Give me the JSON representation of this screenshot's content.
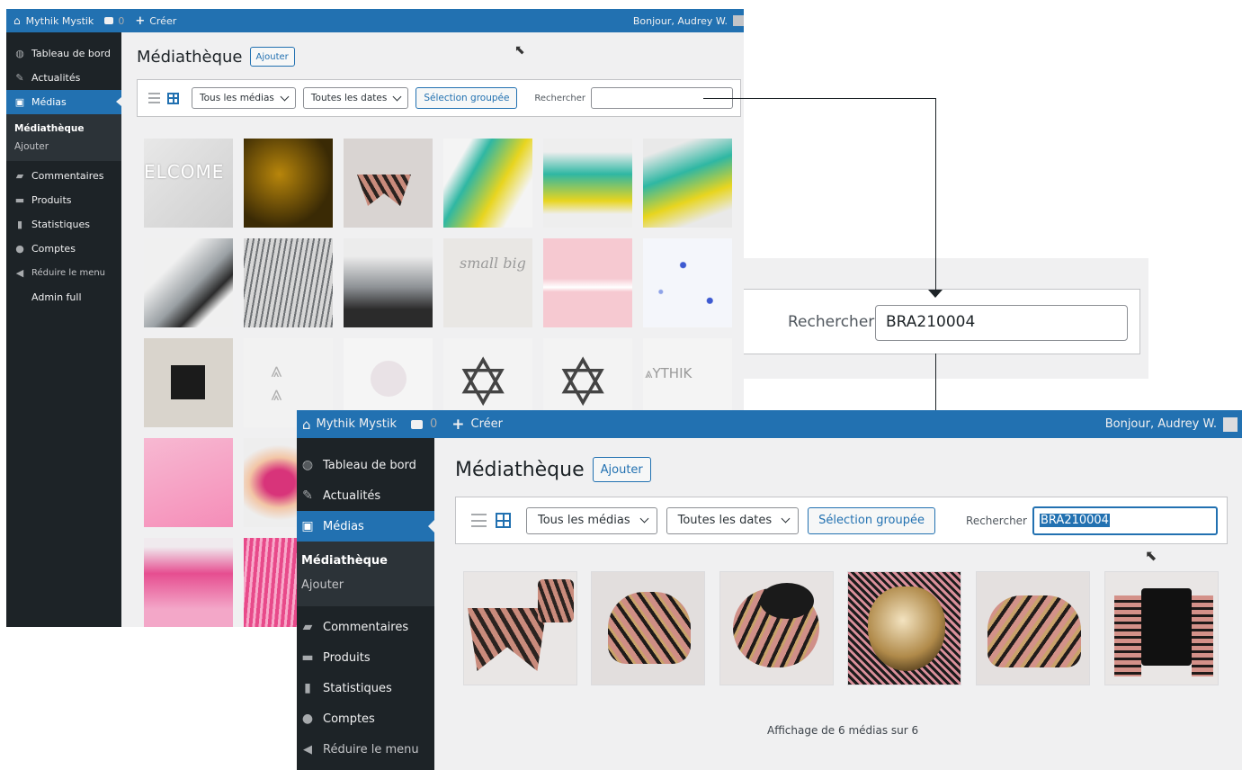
{
  "colors": {
    "admin_bar": "#2271b1",
    "sidebar": "#1d2327",
    "accent": "#2271b1",
    "content_bg": "#f0f0f1"
  },
  "back_screen": {
    "admin_bar": {
      "site_name": "Mythik Mystik",
      "comments_count": "0",
      "new_label": "Créer",
      "greeting": "Bonjour, Audrey W."
    },
    "sidebar": {
      "items": [
        {
          "label": "Tableau de bord",
          "icon": "dashboard-icon"
        },
        {
          "label": "Actualités",
          "icon": "pin-icon"
        },
        {
          "label": "Médias",
          "icon": "media-icon"
        },
        {
          "label": "Commentaires",
          "icon": "comment-icon"
        },
        {
          "label": "Produits",
          "icon": "archive-icon"
        },
        {
          "label": "Statistiques",
          "icon": "chart-bar-icon"
        },
        {
          "label": "Comptes",
          "icon": "user-icon"
        },
        {
          "label": "Réduire le menu",
          "icon": "collapse-icon"
        },
        {
          "label": "Admin full",
          "icon": ""
        }
      ],
      "submenu": [
        "Médiathèque",
        "Ajouter"
      ]
    },
    "page_title": "Médiathèque",
    "add_button": "Ajouter",
    "filter_type": "Tous les médias",
    "filter_date": "Toutes les dates",
    "bulk_select": "Sélection groupée",
    "search_label": "Rechercher",
    "search_value": ""
  },
  "zoom_callout": {
    "search_label": "Rechercher",
    "search_value": "BRA210004"
  },
  "front_screen": {
    "admin_bar": {
      "site_name": "Mythik Mystik",
      "comments_count": "0",
      "new_label": "Créer",
      "greeting": "Bonjour, Audrey W."
    },
    "sidebar": {
      "items": [
        {
          "label": "Tableau de bord",
          "icon": "dashboard-icon"
        },
        {
          "label": "Actualités",
          "icon": "pin-icon"
        },
        {
          "label": "Médias",
          "icon": "media-icon"
        },
        {
          "label": "Commentaires",
          "icon": "comment-icon"
        },
        {
          "label": "Produits",
          "icon": "archive-icon"
        },
        {
          "label": "Statistiques",
          "icon": "chart-bar-icon"
        },
        {
          "label": "Comptes",
          "icon": "user-icon"
        },
        {
          "label": "Réduire le menu",
          "icon": "collapse-icon"
        }
      ],
      "submenu": [
        "Médiathèque",
        "Ajouter"
      ]
    },
    "page_title": "Médiathèque",
    "add_button": "Ajouter",
    "filter_type": "Tous les médias",
    "filter_date": "Toutes les dates",
    "bulk_select": "Sélection groupée",
    "search_label": "Rechercher",
    "search_value": "BRA210004",
    "results_text": "Affichage de 6 médias sur 6"
  }
}
